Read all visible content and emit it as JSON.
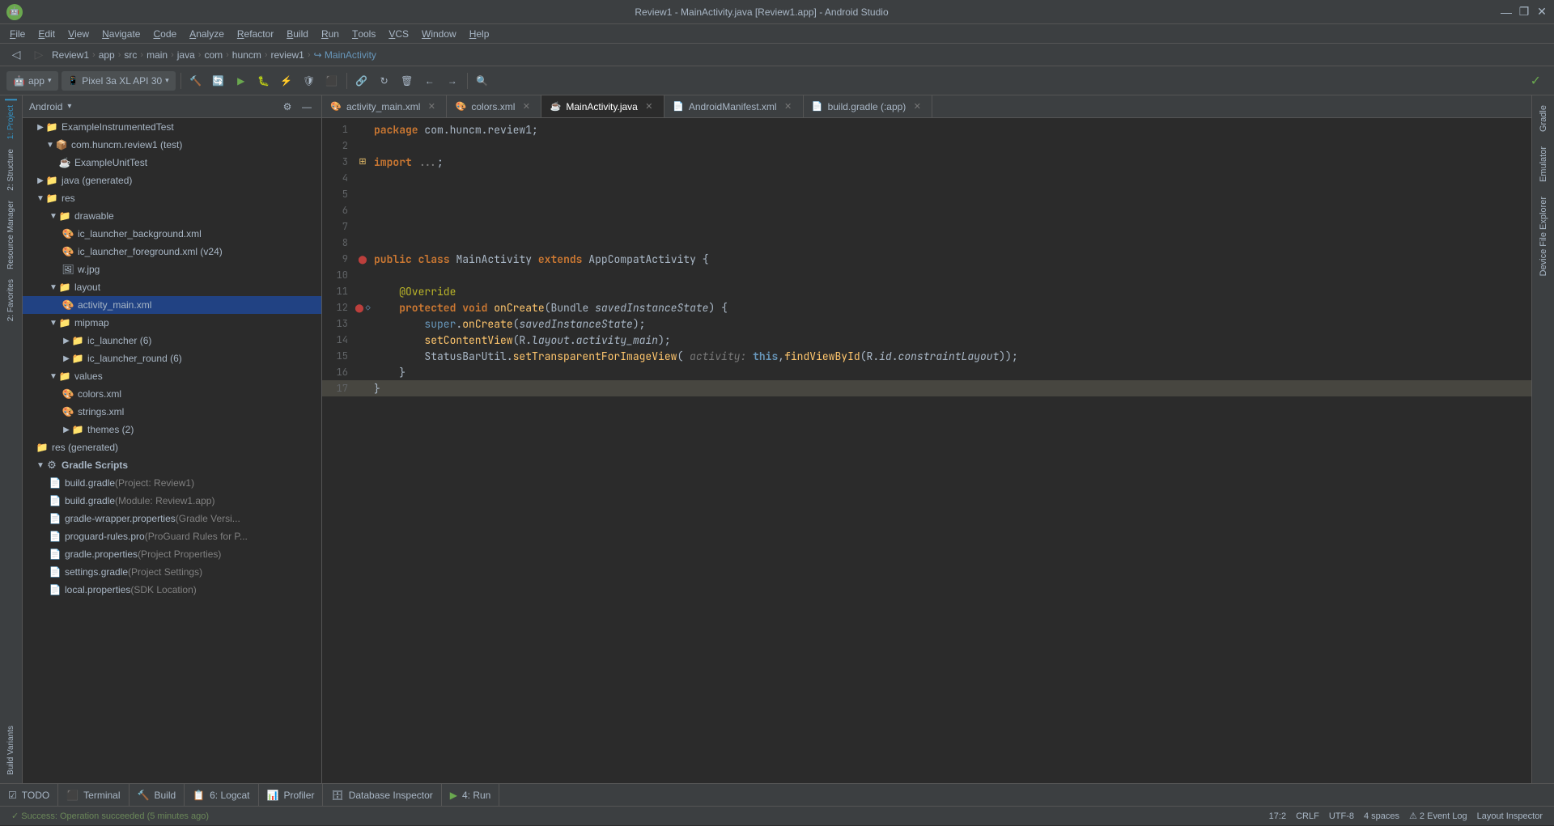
{
  "titleBar": {
    "title": "Review1 - MainActivity.java [Review1.app] - Android Studio",
    "minimize": "—",
    "maximize": "❐",
    "close": "✕"
  },
  "menuBar": {
    "items": [
      {
        "label": "File",
        "underline": "F"
      },
      {
        "label": "Edit",
        "underline": "E"
      },
      {
        "label": "View",
        "underline": "V"
      },
      {
        "label": "Navigate",
        "underline": "N"
      },
      {
        "label": "Code",
        "underline": "C"
      },
      {
        "label": "Analyze",
        "underline": "A"
      },
      {
        "label": "Refactor",
        "underline": "R"
      },
      {
        "label": "Build",
        "underline": "B"
      },
      {
        "label": "Run",
        "underline": "R"
      },
      {
        "label": "Tools",
        "underline": "T"
      },
      {
        "label": "VCS",
        "underline": "V"
      },
      {
        "label": "Window",
        "underline": "W"
      },
      {
        "label": "Help",
        "underline": "H"
      }
    ]
  },
  "breadcrumb": {
    "items": [
      "Review1",
      "app",
      "src",
      "main",
      "java",
      "com",
      "huncm",
      "review1",
      "MainActivity"
    ]
  },
  "runConfig": {
    "label": "app",
    "device": "Pixel 3a XL API 30"
  },
  "projectPanel": {
    "title": "Android",
    "dropdown": "▾",
    "tree": [
      {
        "indent": 0,
        "type": "folder",
        "label": "ExampleInstrumentedTest",
        "expanded": false,
        "icon": "📄",
        "iconColor": "#6897bb"
      },
      {
        "indent": 1,
        "type": "folder",
        "label": "com.huncm.review1 (test)",
        "expanded": true,
        "icon": "📁",
        "iconColor": "#b6bf7f",
        "arrow": "▼"
      },
      {
        "indent": 2,
        "type": "file",
        "label": "ExampleUnitTest",
        "icon": "📄",
        "iconColor": "#6897bb"
      },
      {
        "indent": 0,
        "type": "folder",
        "label": "java (generated)",
        "expanded": false,
        "icon": "📁",
        "iconColor": "#b6bf7f",
        "arrow": "▶"
      },
      {
        "indent": 0,
        "type": "folder",
        "label": "res",
        "expanded": true,
        "icon": "📁",
        "iconColor": "#b6bf7f",
        "arrow": "▼"
      },
      {
        "indent": 1,
        "type": "folder",
        "label": "drawable",
        "expanded": true,
        "icon": "📁",
        "iconColor": "#b6bf7f",
        "arrow": "▼"
      },
      {
        "indent": 2,
        "type": "file",
        "label": "ic_launcher_background.xml",
        "icon": "🎨",
        "iconColor": "#e8bf6a"
      },
      {
        "indent": 2,
        "type": "file",
        "label": "ic_launcher_foreground.xml (v24)",
        "icon": "🎨",
        "iconColor": "#e8bf6a"
      },
      {
        "indent": 2,
        "type": "file",
        "label": "w.jpg",
        "icon": "🖼",
        "iconColor": "#a9b7c6"
      },
      {
        "indent": 1,
        "type": "folder",
        "label": "layout",
        "expanded": true,
        "icon": "📁",
        "iconColor": "#b6bf7f",
        "arrow": "▼"
      },
      {
        "indent": 2,
        "type": "file",
        "label": "activity_main.xml",
        "icon": "🎨",
        "iconColor": "#e8bf6a",
        "selected": true
      },
      {
        "indent": 1,
        "type": "folder",
        "label": "mipmap",
        "expanded": true,
        "icon": "📁",
        "iconColor": "#b6bf7f",
        "arrow": "▼"
      },
      {
        "indent": 2,
        "type": "folder",
        "label": "ic_launcher (6)",
        "expanded": false,
        "icon": "📁",
        "iconColor": "#b6bf7f",
        "arrow": "▶"
      },
      {
        "indent": 2,
        "type": "folder",
        "label": "ic_launcher_round (6)",
        "expanded": false,
        "icon": "📁",
        "iconColor": "#b6bf7f",
        "arrow": "▶"
      },
      {
        "indent": 1,
        "type": "folder",
        "label": "values",
        "expanded": true,
        "icon": "📁",
        "iconColor": "#b6bf7f",
        "arrow": "▼"
      },
      {
        "indent": 2,
        "type": "file",
        "label": "colors.xml",
        "icon": "🎨",
        "iconColor": "#e8bf6a"
      },
      {
        "indent": 2,
        "type": "file",
        "label": "strings.xml",
        "icon": "🎨",
        "iconColor": "#e8bf6a"
      },
      {
        "indent": 2,
        "type": "folder",
        "label": "themes (2)",
        "expanded": false,
        "icon": "📁",
        "iconColor": "#b6bf7f",
        "arrow": "▶"
      },
      {
        "indent": 0,
        "type": "folder",
        "label": "res (generated)",
        "expanded": false,
        "icon": "📁",
        "iconColor": "#b6bf7f"
      },
      {
        "indent": 0,
        "type": "folder",
        "label": "Gradle Scripts",
        "expanded": true,
        "icon": "⚙",
        "iconColor": "#a9b7c6",
        "arrow": "▼"
      },
      {
        "indent": 1,
        "type": "file",
        "label": "build.gradle",
        "labelSecondary": " (Project: Review1)",
        "icon": "📄",
        "iconColor": "#a9b7c6"
      },
      {
        "indent": 1,
        "type": "file",
        "label": "build.gradle",
        "labelSecondary": " (Module: Review1.app)",
        "icon": "📄",
        "iconColor": "#a9b7c6"
      },
      {
        "indent": 1,
        "type": "file",
        "label": "gradle-wrapper.properties",
        "labelSecondary": " (Gradle Versi...",
        "icon": "📄",
        "iconColor": "#a9b7c6"
      },
      {
        "indent": 1,
        "type": "file",
        "label": "proguard-rules.pro",
        "labelSecondary": " (ProGuard Rules for P...",
        "icon": "📄",
        "iconColor": "#a9b7c6"
      },
      {
        "indent": 1,
        "type": "file",
        "label": "gradle.properties",
        "labelSecondary": " (Project Properties)",
        "icon": "📄",
        "iconColor": "#a9b7c6"
      },
      {
        "indent": 1,
        "type": "file",
        "label": "settings.gradle",
        "labelSecondary": " (Project Settings)",
        "icon": "📄",
        "iconColor": "#a9b7c6"
      },
      {
        "indent": 1,
        "type": "file",
        "label": "local.properties",
        "labelSecondary": " (SDK Location)",
        "icon": "📄",
        "iconColor": "#a9b7c6"
      }
    ]
  },
  "tabs": [
    {
      "label": "activity_main.xml",
      "icon": "🎨",
      "active": false,
      "closeable": true
    },
    {
      "label": "colors.xml",
      "icon": "🎨",
      "active": false,
      "closeable": true
    },
    {
      "label": "MainActivity.java",
      "icon": "☕",
      "active": true,
      "closeable": true
    },
    {
      "label": "AndroidManifest.xml",
      "icon": "📄",
      "active": false,
      "closeable": true
    },
    {
      "label": "build.gradle (:app)",
      "icon": "📄",
      "active": false,
      "closeable": true
    }
  ],
  "codeLines": [
    {
      "num": 1,
      "content": "package com.huncm.review1;",
      "type": "package"
    },
    {
      "num": 2,
      "content": "",
      "type": "blank"
    },
    {
      "num": 3,
      "content": "import ...;",
      "type": "import",
      "folded": true
    },
    {
      "num": 4,
      "content": "",
      "type": "blank"
    },
    {
      "num": 5,
      "content": "",
      "type": "blank"
    },
    {
      "num": 6,
      "content": "",
      "type": "blank"
    },
    {
      "num": 7,
      "content": "",
      "type": "blank"
    },
    {
      "num": 8,
      "content": "",
      "type": "blank"
    },
    {
      "num": 9,
      "content": "public class MainActivity extends AppCompatActivity {",
      "type": "class"
    },
    {
      "num": 10,
      "content": "",
      "type": "blank"
    },
    {
      "num": 11,
      "content": "    @Override",
      "type": "annotation"
    },
    {
      "num": 12,
      "content": "    protected void onCreate(Bundle savedInstanceState) {",
      "type": "method",
      "bookmark": true
    },
    {
      "num": 13,
      "content": "        super.onCreate(savedInstanceState);",
      "type": "code"
    },
    {
      "num": 14,
      "content": "        setContentView(R.layout.activity_main);",
      "type": "code"
    },
    {
      "num": 15,
      "content": "        StatusBarUtil.setTransparentForImageView( activity: this,findViewById(R.id.constraintLayout));",
      "type": "code"
    },
    {
      "num": 16,
      "content": "    }",
      "type": "code"
    },
    {
      "num": 17,
      "content": "}",
      "type": "code",
      "highlighted": true
    }
  ],
  "bottomTabs": [
    {
      "label": "TODO",
      "icon": "☑"
    },
    {
      "label": "Terminal",
      "icon": "⬛"
    },
    {
      "label": "Build",
      "icon": "🔨"
    },
    {
      "label": "6: Logcat",
      "icon": "📋"
    },
    {
      "label": "Profiler",
      "icon": "📊"
    },
    {
      "label": "Database Inspector",
      "icon": "🗄"
    },
    {
      "label": "4: Run",
      "icon": "▶"
    }
  ],
  "statusBar": {
    "message": "✓ Success: Operation succeeded (5 minutes ago)",
    "position": "17:2",
    "lineEnding": "CRLF",
    "encoding": "UTF-8",
    "indent": "4 spaces",
    "rightTools": [
      "Event Log",
      "Layout Inspector"
    ],
    "eventLogIcon": "⚠",
    "eventLogCount": "2"
  },
  "leftTabs": [
    {
      "label": "1: Project"
    },
    {
      "label": "2: Structure"
    },
    {
      "label": "2: Favorites"
    },
    {
      "label": "Build Variants"
    }
  ],
  "rightTabs": [
    {
      "label": "Gradle"
    },
    {
      "label": "Emulator"
    },
    {
      "label": "Device File Explorer"
    }
  ]
}
